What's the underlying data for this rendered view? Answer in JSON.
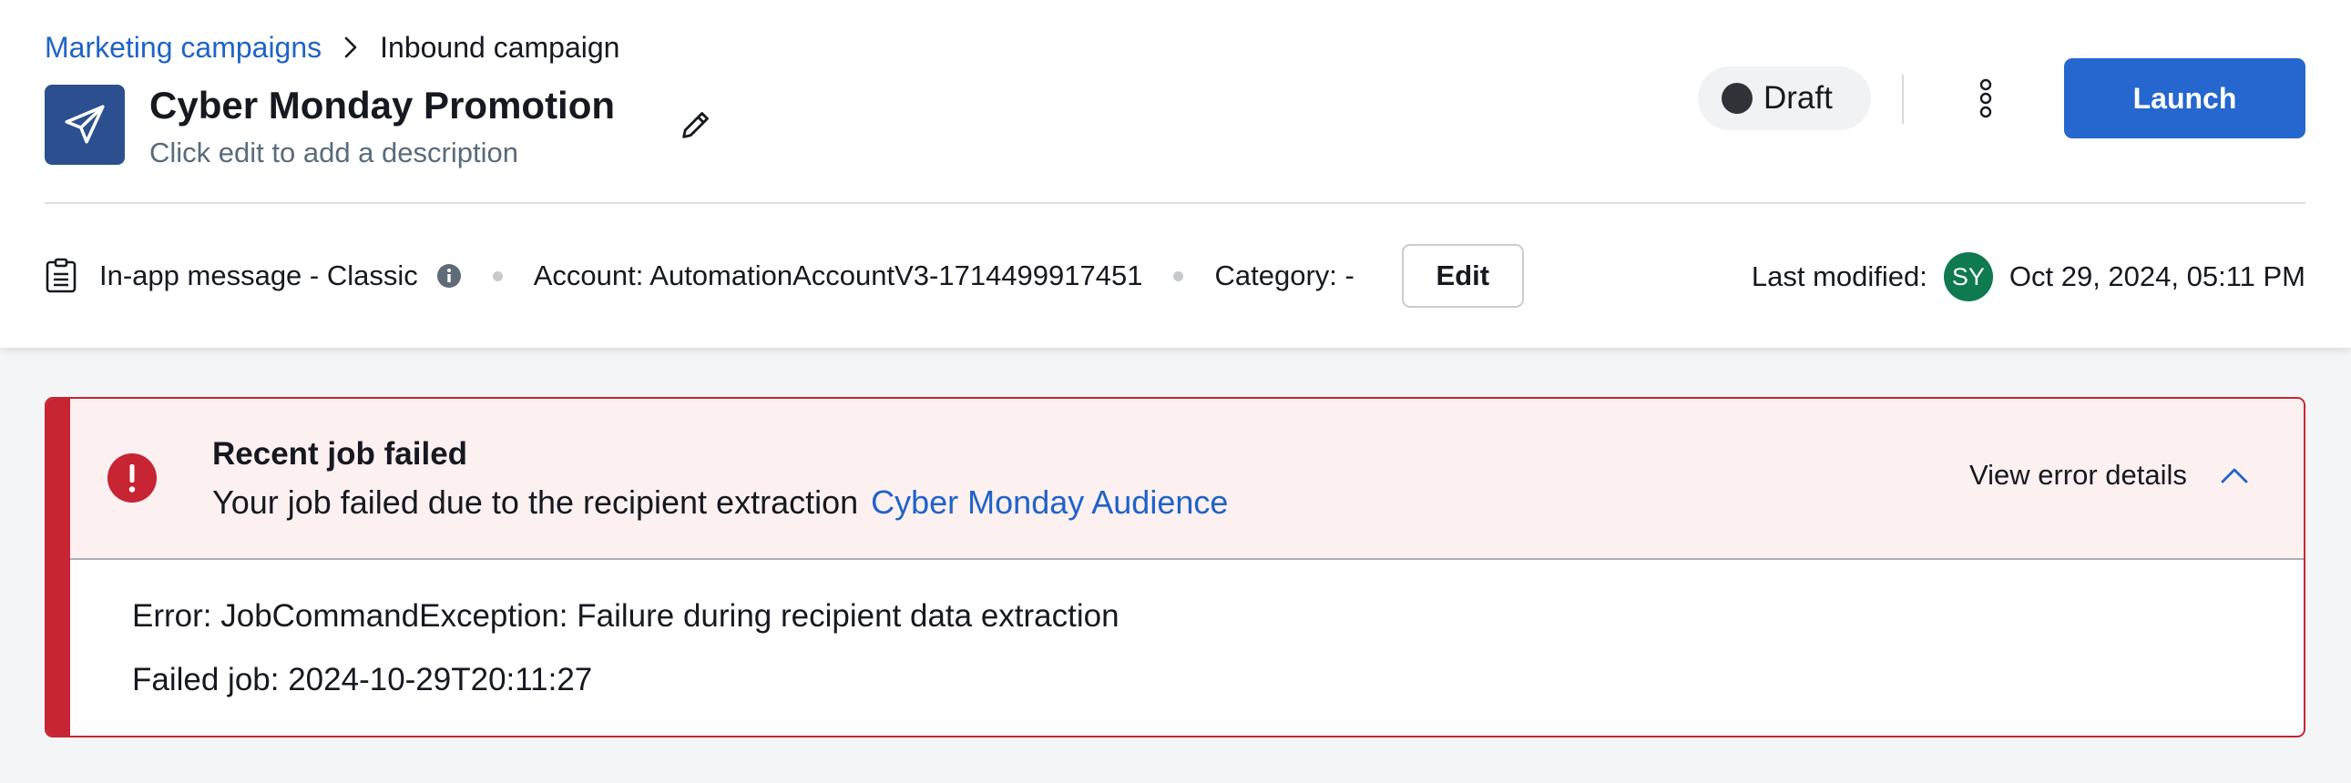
{
  "breadcrumb": {
    "parent": "Marketing campaigns",
    "current": "Inbound campaign"
  },
  "campaign": {
    "icon": "paper-plane-icon",
    "title": "Cyber Monday Promotion",
    "description": "Click edit to add a description"
  },
  "status": {
    "label": "Draft"
  },
  "actions": {
    "launch_label": "Launch"
  },
  "meta": {
    "type": "In-app message - Classic",
    "account": "Account: AutomationAccountV3-1714499917451",
    "category": "Category: -",
    "edit_label": "Edit",
    "last_modified_label": "Last modified:",
    "modifier_initials": "SY",
    "last_modified_date": "Oct 29, 2024, 05:11 PM"
  },
  "alert": {
    "title": "Recent job failed",
    "message": "Your job failed due to the recipient extraction",
    "link": "Cyber Monday Audience",
    "toggle_label": "View error details",
    "error_line": "Error: JobCommandException: Failure during recipient data extraction",
    "failed_job_line": "Failed job: 2024-10-29T20:11:27"
  },
  "colors": {
    "primary": "#2566cf",
    "link": "#1f63c8",
    "error": "#c72434",
    "error_bg": "#fcf0f1",
    "campaign_icon_bg": "#2c4f8f",
    "avatar_bg": "#0f7a4f"
  }
}
